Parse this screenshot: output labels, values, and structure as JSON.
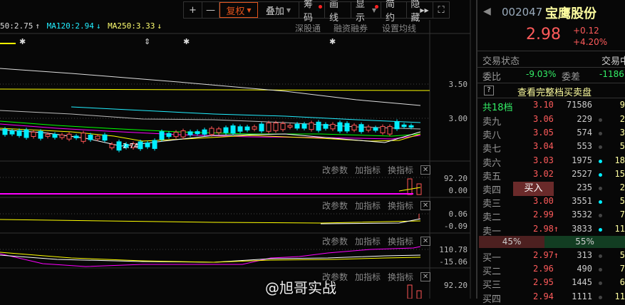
{
  "toolbar": {
    "plus": "+",
    "minus": "—",
    "fuquan": "复权",
    "diejia": "叠加",
    "chouma": "筹码",
    "huaxian": "画线",
    "xianshi": "显示",
    "jianyue": "简约",
    "yincang": "隐藏",
    "expand": "⛶"
  },
  "ma": {
    "ma60": "50:2.75",
    "ma120": "MA120:2.94",
    "ma250": "MA250:3.33"
  },
  "links": {
    "sgt": "深股通",
    "rzrq": "融资融券",
    "setma": "设置均线"
  },
  "axis": {
    "main": [
      "3.50",
      "3.00"
    ],
    "p1": [
      "92.20",
      "0.00"
    ],
    "p2": [
      "0.06",
      "-0.09"
    ],
    "p3": [
      "110.78",
      "-15.06"
    ],
    "p4": [
      "92.20"
    ]
  },
  "low_label": "2.74",
  "panel": {
    "edit": "改参数",
    "add": "加指标",
    "swap": "换指标",
    "close": "✕"
  },
  "watermark": "@旭哥实战",
  "stock": {
    "code": "002047",
    "name": "宝鹰股份",
    "price": "2.98",
    "change": "+0.12",
    "pct": "+4.20%"
  },
  "status": {
    "label": "交易状态",
    "value": "交易中"
  },
  "weibi": {
    "label": "委比",
    "value": "-9.03%",
    "diff_label": "委差",
    "diff": "-1186"
  },
  "full_book": {
    "help": "?",
    "label": "查看完整档买卖盘"
  },
  "total": {
    "label": "共18档",
    "price": "3.10",
    "vol": "71586",
    "cnt": "9"
  },
  "asks": [
    {
      "l": "卖九",
      "p": "3.06",
      "v": "229",
      "c": "2",
      "dot": "grey"
    },
    {
      "l": "卖八",
      "p": "3.05",
      "v": "574",
      "c": "3",
      "dot": "grey"
    },
    {
      "l": "卖七",
      "p": "3.04",
      "v": "553",
      "c": "5",
      "dot": "grey"
    },
    {
      "l": "卖六",
      "p": "3.03",
      "v": "1975",
      "c": "18",
      "dot": "cyan"
    },
    {
      "l": "卖五",
      "p": "3.02",
      "v": "2527",
      "c": "15",
      "dot": "cyan"
    },
    {
      "l": "卖四",
      "p": "3.01",
      "v": "235",
      "c": "2",
      "dot": "grey"
    },
    {
      "l": "卖三",
      "p": "3.00",
      "v": "3551",
      "c": "5",
      "dot": "cyan"
    },
    {
      "l": "卖二",
      "p": "2.99",
      "v": "3532",
      "c": "7",
      "dot": "grey"
    },
    {
      "l": "卖一",
      "p": "2.98↑",
      "v": "3833",
      "c": "11",
      "dot": "cyan"
    }
  ],
  "buy_button": "买入",
  "ratio": {
    "buy": "45%",
    "sell": "55%",
    "buy_frac": 0.45
  },
  "bids": [
    {
      "l": "买一",
      "p": "2.97↑",
      "v": "313",
      "c": "5",
      "dot": "grey"
    },
    {
      "l": "买二",
      "p": "2.96",
      "v": "490",
      "c": "7",
      "dot": "grey"
    },
    {
      "l": "买三",
      "p": "2.95",
      "v": "1445",
      "c": "6",
      "dot": "grey"
    },
    {
      "l": "买四",
      "p": "2.94",
      "v": "1111",
      "c": "11",
      "dot": "grey"
    }
  ]
}
